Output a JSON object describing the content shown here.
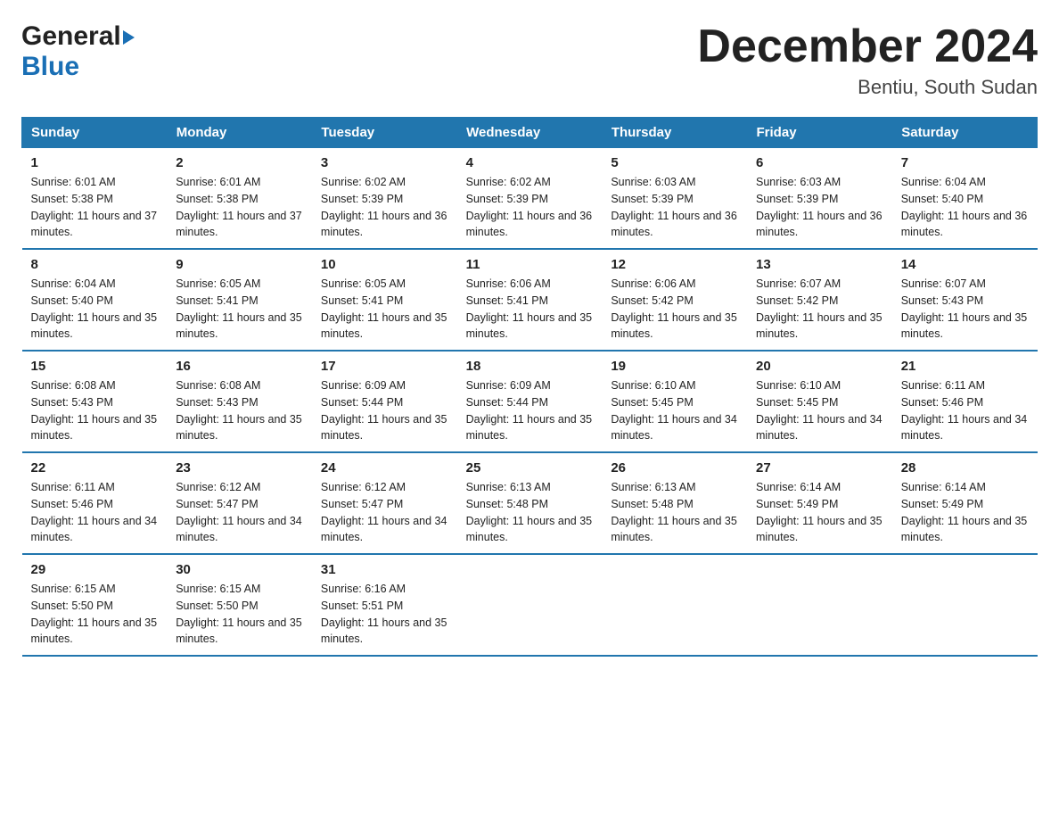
{
  "logo": {
    "general": "General",
    "blue": "Blue"
  },
  "title": "December 2024",
  "location": "Bentiu, South Sudan",
  "days_of_week": [
    "Sunday",
    "Monday",
    "Tuesday",
    "Wednesday",
    "Thursday",
    "Friday",
    "Saturday"
  ],
  "weeks": [
    [
      {
        "num": "1",
        "sunrise": "Sunrise: 6:01 AM",
        "sunset": "Sunset: 5:38 PM",
        "daylight": "Daylight: 11 hours and 37 minutes."
      },
      {
        "num": "2",
        "sunrise": "Sunrise: 6:01 AM",
        "sunset": "Sunset: 5:38 PM",
        "daylight": "Daylight: 11 hours and 37 minutes."
      },
      {
        "num": "3",
        "sunrise": "Sunrise: 6:02 AM",
        "sunset": "Sunset: 5:39 PM",
        "daylight": "Daylight: 11 hours and 36 minutes."
      },
      {
        "num": "4",
        "sunrise": "Sunrise: 6:02 AM",
        "sunset": "Sunset: 5:39 PM",
        "daylight": "Daylight: 11 hours and 36 minutes."
      },
      {
        "num": "5",
        "sunrise": "Sunrise: 6:03 AM",
        "sunset": "Sunset: 5:39 PM",
        "daylight": "Daylight: 11 hours and 36 minutes."
      },
      {
        "num": "6",
        "sunrise": "Sunrise: 6:03 AM",
        "sunset": "Sunset: 5:39 PM",
        "daylight": "Daylight: 11 hours and 36 minutes."
      },
      {
        "num": "7",
        "sunrise": "Sunrise: 6:04 AM",
        "sunset": "Sunset: 5:40 PM",
        "daylight": "Daylight: 11 hours and 36 minutes."
      }
    ],
    [
      {
        "num": "8",
        "sunrise": "Sunrise: 6:04 AM",
        "sunset": "Sunset: 5:40 PM",
        "daylight": "Daylight: 11 hours and 35 minutes."
      },
      {
        "num": "9",
        "sunrise": "Sunrise: 6:05 AM",
        "sunset": "Sunset: 5:41 PM",
        "daylight": "Daylight: 11 hours and 35 minutes."
      },
      {
        "num": "10",
        "sunrise": "Sunrise: 6:05 AM",
        "sunset": "Sunset: 5:41 PM",
        "daylight": "Daylight: 11 hours and 35 minutes."
      },
      {
        "num": "11",
        "sunrise": "Sunrise: 6:06 AM",
        "sunset": "Sunset: 5:41 PM",
        "daylight": "Daylight: 11 hours and 35 minutes."
      },
      {
        "num": "12",
        "sunrise": "Sunrise: 6:06 AM",
        "sunset": "Sunset: 5:42 PM",
        "daylight": "Daylight: 11 hours and 35 minutes."
      },
      {
        "num": "13",
        "sunrise": "Sunrise: 6:07 AM",
        "sunset": "Sunset: 5:42 PM",
        "daylight": "Daylight: 11 hours and 35 minutes."
      },
      {
        "num": "14",
        "sunrise": "Sunrise: 6:07 AM",
        "sunset": "Sunset: 5:43 PM",
        "daylight": "Daylight: 11 hours and 35 minutes."
      }
    ],
    [
      {
        "num": "15",
        "sunrise": "Sunrise: 6:08 AM",
        "sunset": "Sunset: 5:43 PM",
        "daylight": "Daylight: 11 hours and 35 minutes."
      },
      {
        "num": "16",
        "sunrise": "Sunrise: 6:08 AM",
        "sunset": "Sunset: 5:43 PM",
        "daylight": "Daylight: 11 hours and 35 minutes."
      },
      {
        "num": "17",
        "sunrise": "Sunrise: 6:09 AM",
        "sunset": "Sunset: 5:44 PM",
        "daylight": "Daylight: 11 hours and 35 minutes."
      },
      {
        "num": "18",
        "sunrise": "Sunrise: 6:09 AM",
        "sunset": "Sunset: 5:44 PM",
        "daylight": "Daylight: 11 hours and 35 minutes."
      },
      {
        "num": "19",
        "sunrise": "Sunrise: 6:10 AM",
        "sunset": "Sunset: 5:45 PM",
        "daylight": "Daylight: 11 hours and 34 minutes."
      },
      {
        "num": "20",
        "sunrise": "Sunrise: 6:10 AM",
        "sunset": "Sunset: 5:45 PM",
        "daylight": "Daylight: 11 hours and 34 minutes."
      },
      {
        "num": "21",
        "sunrise": "Sunrise: 6:11 AM",
        "sunset": "Sunset: 5:46 PM",
        "daylight": "Daylight: 11 hours and 34 minutes."
      }
    ],
    [
      {
        "num": "22",
        "sunrise": "Sunrise: 6:11 AM",
        "sunset": "Sunset: 5:46 PM",
        "daylight": "Daylight: 11 hours and 34 minutes."
      },
      {
        "num": "23",
        "sunrise": "Sunrise: 6:12 AM",
        "sunset": "Sunset: 5:47 PM",
        "daylight": "Daylight: 11 hours and 34 minutes."
      },
      {
        "num": "24",
        "sunrise": "Sunrise: 6:12 AM",
        "sunset": "Sunset: 5:47 PM",
        "daylight": "Daylight: 11 hours and 34 minutes."
      },
      {
        "num": "25",
        "sunrise": "Sunrise: 6:13 AM",
        "sunset": "Sunset: 5:48 PM",
        "daylight": "Daylight: 11 hours and 35 minutes."
      },
      {
        "num": "26",
        "sunrise": "Sunrise: 6:13 AM",
        "sunset": "Sunset: 5:48 PM",
        "daylight": "Daylight: 11 hours and 35 minutes."
      },
      {
        "num": "27",
        "sunrise": "Sunrise: 6:14 AM",
        "sunset": "Sunset: 5:49 PM",
        "daylight": "Daylight: 11 hours and 35 minutes."
      },
      {
        "num": "28",
        "sunrise": "Sunrise: 6:14 AM",
        "sunset": "Sunset: 5:49 PM",
        "daylight": "Daylight: 11 hours and 35 minutes."
      }
    ],
    [
      {
        "num": "29",
        "sunrise": "Sunrise: 6:15 AM",
        "sunset": "Sunset: 5:50 PM",
        "daylight": "Daylight: 11 hours and 35 minutes."
      },
      {
        "num": "30",
        "sunrise": "Sunrise: 6:15 AM",
        "sunset": "Sunset: 5:50 PM",
        "daylight": "Daylight: 11 hours and 35 minutes."
      },
      {
        "num": "31",
        "sunrise": "Sunrise: 6:16 AM",
        "sunset": "Sunset: 5:51 PM",
        "daylight": "Daylight: 11 hours and 35 minutes."
      },
      {
        "num": "",
        "sunrise": "",
        "sunset": "",
        "daylight": ""
      },
      {
        "num": "",
        "sunrise": "",
        "sunset": "",
        "daylight": ""
      },
      {
        "num": "",
        "sunrise": "",
        "sunset": "",
        "daylight": ""
      },
      {
        "num": "",
        "sunrise": "",
        "sunset": "",
        "daylight": ""
      }
    ]
  ]
}
